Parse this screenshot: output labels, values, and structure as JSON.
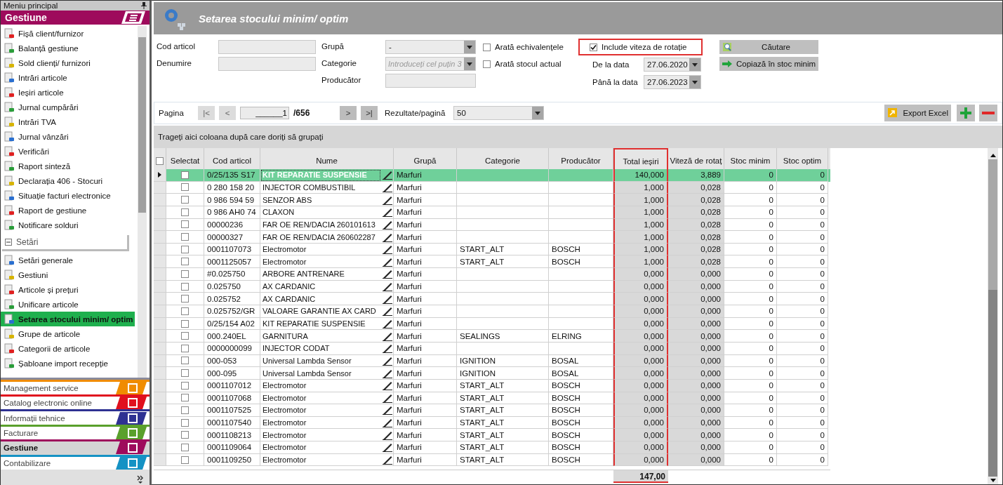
{
  "sidebar": {
    "title": "Meniu principal",
    "group_title": "Gestiune",
    "items": [
      {
        "label": "Fișă client/furnizor",
        "selected": false
      },
      {
        "label": "Balanță gestiune",
        "selected": false
      },
      {
        "label": "Sold clienți/ furnizori",
        "selected": false
      },
      {
        "label": "Intrări articole",
        "selected": false
      },
      {
        "label": "Ieșiri articole",
        "selected": false
      },
      {
        "label": "Jurnal cumpărări",
        "selected": false
      },
      {
        "label": "Intrări TVA",
        "selected": false
      },
      {
        "label": "Jurnal vânzări",
        "selected": false
      },
      {
        "label": "Verificări",
        "selected": false
      },
      {
        "label": "Raport sinteză",
        "selected": false
      },
      {
        "label": "Declarația 406 - Stocuri",
        "selected": false
      },
      {
        "label": "Situație facturi electronice",
        "selected": false
      },
      {
        "label": "Raport de gestiune",
        "selected": false
      },
      {
        "label": "Notificare solduri",
        "selected": false
      }
    ],
    "section": {
      "label": "Setări",
      "expanded": true,
      "items": [
        {
          "label": "Setări generale",
          "selected": false
        },
        {
          "label": "Gestiuni",
          "selected": false
        },
        {
          "label": "Articole și prețuri",
          "selected": false
        },
        {
          "label": "Unificare articole",
          "selected": false
        },
        {
          "label": "Setarea stocului minim/ optim",
          "selected": true
        },
        {
          "label": "Grupe de articole",
          "selected": false
        },
        {
          "label": "Categorii de articole",
          "selected": false
        },
        {
          "label": "Șabloane import recepție",
          "selected": false
        }
      ]
    },
    "modules": [
      {
        "label": "Management service",
        "color": "#f08c00",
        "selected": false
      },
      {
        "label": "Catalog electronic online",
        "color": "#e0101e",
        "selected": false
      },
      {
        "label": "Informații tehnice",
        "color": "#2e3192",
        "selected": false
      },
      {
        "label": "Facturare",
        "color": "#5aa02c",
        "selected": false
      },
      {
        "label": "Gestiune",
        "color": "#9e0b5c",
        "selected": true
      },
      {
        "label": "Contabilizare",
        "color": "#1592c4",
        "selected": false
      }
    ]
  },
  "header": {
    "title": "Setarea stocului minim/ optim"
  },
  "filters": {
    "code": {
      "label": "Cod articol"
    },
    "name": {
      "label": "Denumire"
    },
    "group": {
      "label": "Grupă",
      "value": "-"
    },
    "category": {
      "label": "Categorie",
      "placeholder": "Introduceți cel puțin 3"
    },
    "producer": {
      "label": "Producător"
    },
    "options": [
      {
        "label": "Arată echivalențele",
        "checked": false,
        "highlighted": false
      },
      {
        "label": "Arată stocul actual",
        "checked": false,
        "highlighted": false
      },
      {
        "label": "Include viteza de rotație",
        "checked": true,
        "highlighted": true
      }
    ],
    "from": {
      "label": "De la data",
      "value": "27.06.2020"
    },
    "to": {
      "label": "Până la data",
      "value": "27.06.2023"
    },
    "buttons": [
      "Căutare",
      "Copiază în stoc minim"
    ]
  },
  "pager": {
    "label": "Pagina",
    "page": "______1",
    "total": "/656",
    "nav": [
      {
        "text": "|<",
        "disabled": true
      },
      {
        "text": "<",
        "disabled": true
      },
      {
        "text": ">",
        "disabled": false
      },
      {
        "text": ">|",
        "disabled": false
      }
    ],
    "per_page_label": "Rezultate/pagină",
    "per_page": "50",
    "export": "Export Excel"
  },
  "group_hint": "Trageți aici coloana după care doriți să grupați",
  "table": {
    "columns": [
      {
        "label": "Selectat",
        "shaded": false,
        "highlighted": false
      },
      {
        "label": "Cod articol",
        "shaded": false,
        "highlighted": false
      },
      {
        "label": "Nume",
        "shaded": false,
        "highlighted": false
      },
      {
        "label": "Grupă",
        "shaded": false,
        "highlighted": false
      },
      {
        "label": "Categorie",
        "shaded": false,
        "highlighted": false
      },
      {
        "label": "Producător",
        "shaded": false,
        "highlighted": false
      },
      {
        "label": "Total ieșiri",
        "shaded": true,
        "highlighted": true
      },
      {
        "label": "Viteză de rotaț",
        "shaded": true,
        "highlighted": false
      },
      {
        "label": "Stoc minim",
        "shaded": false,
        "highlighted": false
      },
      {
        "label": "Stoc optim",
        "shaded": false,
        "highlighted": false
      }
    ],
    "rows": [
      {
        "selected": true,
        "checked": false,
        "code": "0/25/135 S17",
        "name": "KIT REPARATIE SUSPENSIE",
        "group": "Marfuri",
        "total": "140,000",
        "speed": "3,889",
        "min": "0",
        "opt": "0"
      },
      {
        "selected": false,
        "checked": false,
        "code": "0 280 158 20",
        "name": "INJECTOR COMBUSTIBIL",
        "group": "Marfuri",
        "total": "1,000",
        "speed": "0,028",
        "min": "0",
        "opt": "0"
      },
      {
        "selected": false,
        "checked": false,
        "code": "0 986 594 59",
        "name": "SENZOR ABS",
        "group": "Marfuri",
        "total": "1,000",
        "speed": "0,028",
        "min": "0",
        "opt": "0"
      },
      {
        "selected": false,
        "checked": false,
        "code": "0 986 AH0 74",
        "name": "CLAXON",
        "group": "Marfuri",
        "total": "1,000",
        "speed": "0,028",
        "min": "0",
        "opt": "0"
      },
      {
        "selected": false,
        "checked": false,
        "code": "00000236",
        "name": "FAR OE REN/DACIA 260101613",
        "group": "Marfuri",
        "total": "1,000",
        "speed": "0,028",
        "min": "0",
        "opt": "0"
      },
      {
        "selected": false,
        "checked": false,
        "code": "00000327",
        "name": "FAR OE REN/DACIA 260602287",
        "group": "Marfuri",
        "total": "1,000",
        "speed": "0,028",
        "min": "0",
        "opt": "0"
      },
      {
        "selected": false,
        "checked": false,
        "code": "0001107073",
        "name": "Electromotor",
        "group": "Marfuri",
        "category": "START_ALT",
        "producer": "BOSCH",
        "total": "1,000",
        "speed": "0,028",
        "min": "0",
        "opt": "0"
      },
      {
        "selected": false,
        "checked": false,
        "code": "0001125057",
        "name": "Electromotor",
        "group": "Marfuri",
        "category": "START_ALT",
        "producer": "BOSCH",
        "total": "1,000",
        "speed": "0,028",
        "min": "0",
        "opt": "0"
      },
      {
        "selected": false,
        "checked": false,
        "code": "#0.025750",
        "name": "ARBORE ANTRENARE",
        "group": "Marfuri",
        "total": "0,000",
        "speed": "0,000",
        "min": "0",
        "opt": "0"
      },
      {
        "selected": false,
        "checked": false,
        "code": "0.025750",
        "name": "AX CARDANIC",
        "group": "Marfuri",
        "total": "0,000",
        "speed": "0,000",
        "min": "0",
        "opt": "0"
      },
      {
        "selected": false,
        "checked": false,
        "code": "0.025752",
        "name": "AX CARDANIC",
        "group": "Marfuri",
        "total": "0,000",
        "speed": "0,000",
        "min": "0",
        "opt": "0"
      },
      {
        "selected": false,
        "checked": false,
        "code": "0.025752/GR",
        "name": "VALOARE GARANTIE AX CARD",
        "group": "Marfuri",
        "total": "0,000",
        "speed": "0,000",
        "min": "0",
        "opt": "0"
      },
      {
        "selected": false,
        "checked": false,
        "code": "0/25/154 A02",
        "name": "KIT REPARATIE SUSPENSIE",
        "group": "Marfuri",
        "total": "0,000",
        "speed": "0,000",
        "min": "0",
        "opt": "0"
      },
      {
        "selected": false,
        "checked": false,
        "code": "000.240EL",
        "name": "GARNITURA",
        "group": "Marfuri",
        "category": "SEALINGS",
        "producer": "ELRING",
        "total": "0,000",
        "speed": "0,000",
        "min": "0",
        "opt": "0"
      },
      {
        "selected": false,
        "checked": false,
        "code": "0000000099",
        "name": "INJECTOR CODAT",
        "group": "Marfuri",
        "total": "0,000",
        "speed": "0,000",
        "min": "0",
        "opt": "0"
      },
      {
        "selected": false,
        "checked": false,
        "code": "000-053",
        "name": "Universal Lambda Sensor",
        "group": "Marfuri",
        "category": "IGNITION",
        "producer": "BOSAL",
        "total": "0,000",
        "speed": "0,000",
        "min": "0",
        "opt": "0"
      },
      {
        "selected": false,
        "checked": false,
        "code": "000-095",
        "name": "Universal Lambda Sensor",
        "group": "Marfuri",
        "category": "IGNITION",
        "producer": "BOSAL",
        "total": "0,000",
        "speed": "0,000",
        "min": "0",
        "opt": "0"
      },
      {
        "selected": false,
        "checked": false,
        "code": "0001107012",
        "name": "Electromotor",
        "group": "Marfuri",
        "category": "START_ALT",
        "producer": "BOSCH",
        "total": "0,000",
        "speed": "0,000",
        "min": "0",
        "opt": "0"
      },
      {
        "selected": false,
        "checked": false,
        "code": "0001107068",
        "name": "Electromotor",
        "group": "Marfuri",
        "category": "START_ALT",
        "producer": "BOSCH",
        "total": "0,000",
        "speed": "0,000",
        "min": "0",
        "opt": "0"
      },
      {
        "selected": false,
        "checked": false,
        "code": "0001107525",
        "name": "Electromotor",
        "group": "Marfuri",
        "category": "START_ALT",
        "producer": "BOSCH",
        "total": "0,000",
        "speed": "0,000",
        "min": "0",
        "opt": "0"
      },
      {
        "selected": false,
        "checked": false,
        "code": "0001107540",
        "name": "Electromotor",
        "group": "Marfuri",
        "category": "START_ALT",
        "producer": "BOSCH",
        "total": "0,000",
        "speed": "0,000",
        "min": "0",
        "opt": "0"
      },
      {
        "selected": false,
        "checked": false,
        "code": "0001108213",
        "name": "Electromotor",
        "group": "Marfuri",
        "category": "START_ALT",
        "producer": "BOSCH",
        "total": "0,000",
        "speed": "0,000",
        "min": "0",
        "opt": "0"
      },
      {
        "selected": false,
        "checked": false,
        "code": "0001109064",
        "name": "Electromotor",
        "group": "Marfuri",
        "category": "START_ALT",
        "producer": "BOSCH",
        "total": "0,000",
        "speed": "0,000",
        "min": "0",
        "opt": "0"
      },
      {
        "selected": false,
        "checked": false,
        "code": "0001109250",
        "name": "Electromotor",
        "group": "Marfuri",
        "category": "START_ALT",
        "producer": "BOSCH",
        "total": "0,000",
        "speed": "0,000",
        "min": "0",
        "opt": "0"
      }
    ],
    "footer_total": "147,00",
    "select_all_checked": false
  }
}
